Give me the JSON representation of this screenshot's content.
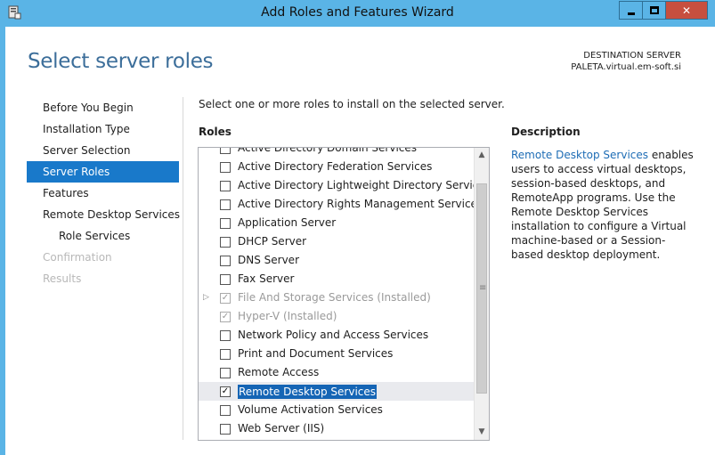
{
  "window": {
    "title": "Add Roles and Features Wizard",
    "icon": "server-manager-icon",
    "controls": {
      "minimize": "minimize-icon",
      "maximize": "maximize-icon",
      "close": "✕"
    }
  },
  "header": {
    "page_title": "Select server roles",
    "destination_label": "DESTINATION SERVER",
    "destination_server": "PALETA.virtual.em-soft.si"
  },
  "nav": {
    "items": [
      {
        "label": "Before You Begin",
        "state": "normal"
      },
      {
        "label": "Installation Type",
        "state": "normal"
      },
      {
        "label": "Server Selection",
        "state": "normal"
      },
      {
        "label": "Server Roles",
        "state": "active"
      },
      {
        "label": "Features",
        "state": "normal"
      },
      {
        "label": "Remote Desktop Services",
        "state": "normal"
      },
      {
        "label": "Role Services",
        "state": "sub"
      },
      {
        "label": "Confirmation",
        "state": "disabled"
      },
      {
        "label": "Results",
        "state": "disabled"
      }
    ]
  },
  "main": {
    "intro": "Select one or more roles to install on the selected server.",
    "roles_label": "Roles",
    "roles": [
      {
        "label": "Active Directory Domain Services",
        "checked": false,
        "disabled": false
      },
      {
        "label": "Active Directory Federation Services",
        "checked": false,
        "disabled": false
      },
      {
        "label": "Active Directory Lightweight Directory Services",
        "checked": false,
        "disabled": false
      },
      {
        "label": "Active Directory Rights Management Services",
        "checked": false,
        "disabled": false
      },
      {
        "label": "Application Server",
        "checked": false,
        "disabled": false
      },
      {
        "label": "DHCP Server",
        "checked": false,
        "disabled": false
      },
      {
        "label": "DNS Server",
        "checked": false,
        "disabled": false
      },
      {
        "label": "Fax Server",
        "checked": false,
        "disabled": false
      },
      {
        "label": "File And Storage Services (Installed)",
        "checked": true,
        "disabled": true,
        "expandable": true
      },
      {
        "label": "Hyper-V (Installed)",
        "checked": true,
        "disabled": true
      },
      {
        "label": "Network Policy and Access Services",
        "checked": false,
        "disabled": false
      },
      {
        "label": "Print and Document Services",
        "checked": false,
        "disabled": false
      },
      {
        "label": "Remote Access",
        "checked": false,
        "disabled": false
      },
      {
        "label": "Remote Desktop Services",
        "checked": true,
        "disabled": false,
        "selected": true
      },
      {
        "label": "Volume Activation Services",
        "checked": false,
        "disabled": false
      },
      {
        "label": "Web Server (IIS)",
        "checked": false,
        "disabled": false
      }
    ],
    "check_glyph": "✓",
    "scroll": {
      "up": "▲",
      "down": "▼",
      "grip": "≡"
    }
  },
  "description": {
    "label": "Description",
    "link_text": "Remote Desktop Services",
    "body": " enables users to access virtual desktops, session-based desktops, and RemoteApp programs. Use the Remote Desktop Services installation to configure a Virtual machine-based or a Session-based desktop deployment."
  },
  "colors": {
    "title_bar": "#5ab4e6",
    "nav_active": "#1979ca",
    "page_title": "#3c6e9a",
    "link": "#1d6cb5",
    "close_button": "#c74f3f"
  }
}
